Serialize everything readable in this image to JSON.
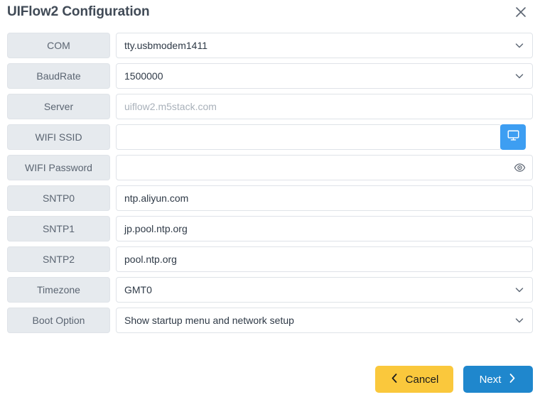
{
  "dialog": {
    "title": "UIFlow2 Configuration",
    "close_icon": "close-icon"
  },
  "form": {
    "rows": [
      {
        "label": "COM",
        "value": "tty.usbmodem1411",
        "placeholder": "",
        "control": "select",
        "is_placeholder": false
      },
      {
        "label": "BaudRate",
        "value": "1500000",
        "placeholder": "",
        "control": "select",
        "is_placeholder": false
      },
      {
        "label": "Server",
        "value": "uiflow2.m5stack.com",
        "placeholder": "uiflow2.m5stack.com",
        "control": "text",
        "is_placeholder": true
      },
      {
        "label": "WIFI SSID",
        "value": "",
        "placeholder": "",
        "control": "text-with-scan",
        "is_placeholder": false
      },
      {
        "label": "WIFI Password",
        "value": "",
        "placeholder": "",
        "control": "password",
        "is_placeholder": false
      },
      {
        "label": "SNTP0",
        "value": "ntp.aliyun.com",
        "placeholder": "",
        "control": "text",
        "is_placeholder": false
      },
      {
        "label": "SNTP1",
        "value": "jp.pool.ntp.org",
        "placeholder": "",
        "control": "text",
        "is_placeholder": false
      },
      {
        "label": "SNTP2",
        "value": "pool.ntp.org",
        "placeholder": "",
        "control": "text",
        "is_placeholder": false
      },
      {
        "label": "Timezone",
        "value": "GMT0",
        "placeholder": "",
        "control": "select",
        "is_placeholder": false
      },
      {
        "label": "Boot Option",
        "value": "Show startup menu and network setup",
        "placeholder": "",
        "control": "select",
        "is_placeholder": false
      }
    ],
    "scan_icon": "monitor-icon",
    "reveal_icon": "eye-icon",
    "dropdown_icon": "chevron-down-icon"
  },
  "footer": {
    "cancel_label": "Cancel",
    "next_label": "Next",
    "cancel_icon": "chevron-left-icon",
    "next_icon": "chevron-right-icon"
  },
  "colors": {
    "label_bg": "#e6eaee",
    "border": "#dfe3e8",
    "accent_blue": "#3d9ef2",
    "next_blue": "#1f87cd",
    "cancel_amber": "#fac83c",
    "text": "#3c4858",
    "placeholder_text": "#a9b1ba"
  }
}
